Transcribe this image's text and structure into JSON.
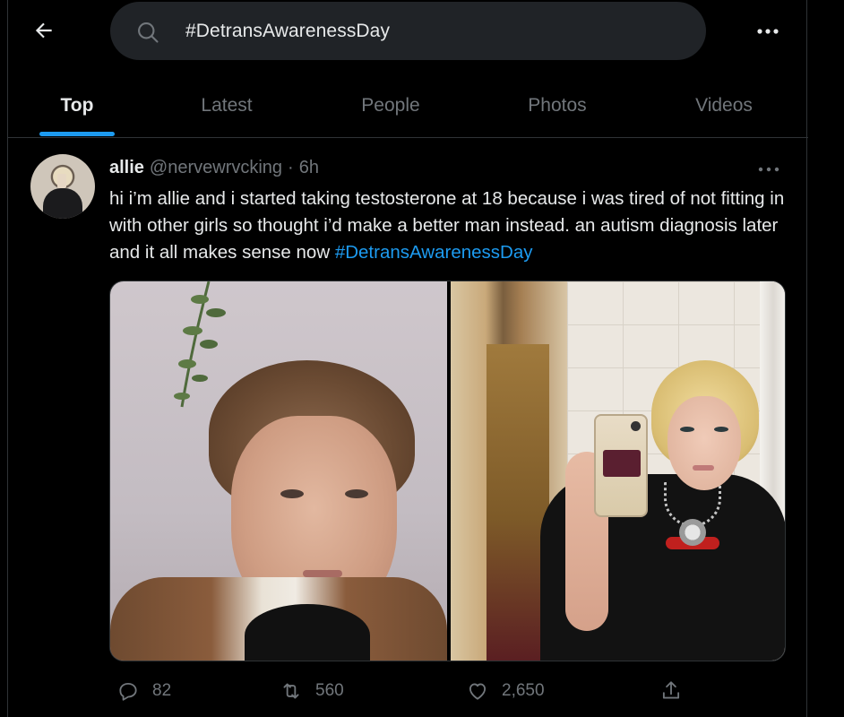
{
  "header": {
    "back_icon": "arrow-left-icon",
    "search_icon": "search-icon",
    "search_value": "#DetransAwarenessDay",
    "more_icon": "more-horizontal-icon"
  },
  "tabs": [
    {
      "label": "Top",
      "active": true
    },
    {
      "label": "Latest",
      "active": false
    },
    {
      "label": "People",
      "active": false
    },
    {
      "label": "Photos",
      "active": false
    },
    {
      "label": "Videos",
      "active": false
    }
  ],
  "tweet": {
    "name": "allie",
    "handle": "@nervewrvcking",
    "separator": "·",
    "time": "6h",
    "text": "hi i’m allie and i started taking testosterone at 18 because i was tired of not fitting in with other girls so thought i’d make a better man instead. an autism diagnosis later and it all makes sense now ",
    "hashtag": "#DetransAwarenessDay",
    "actions": {
      "replies": "82",
      "retweets": "560",
      "likes": "2,650"
    }
  },
  "colors": {
    "accent": "#1d9bf0",
    "background": "#000000",
    "text_primary": "#e7e9ea",
    "text_secondary": "#71767b",
    "search_bg": "#202327",
    "border": "#2f3336"
  }
}
